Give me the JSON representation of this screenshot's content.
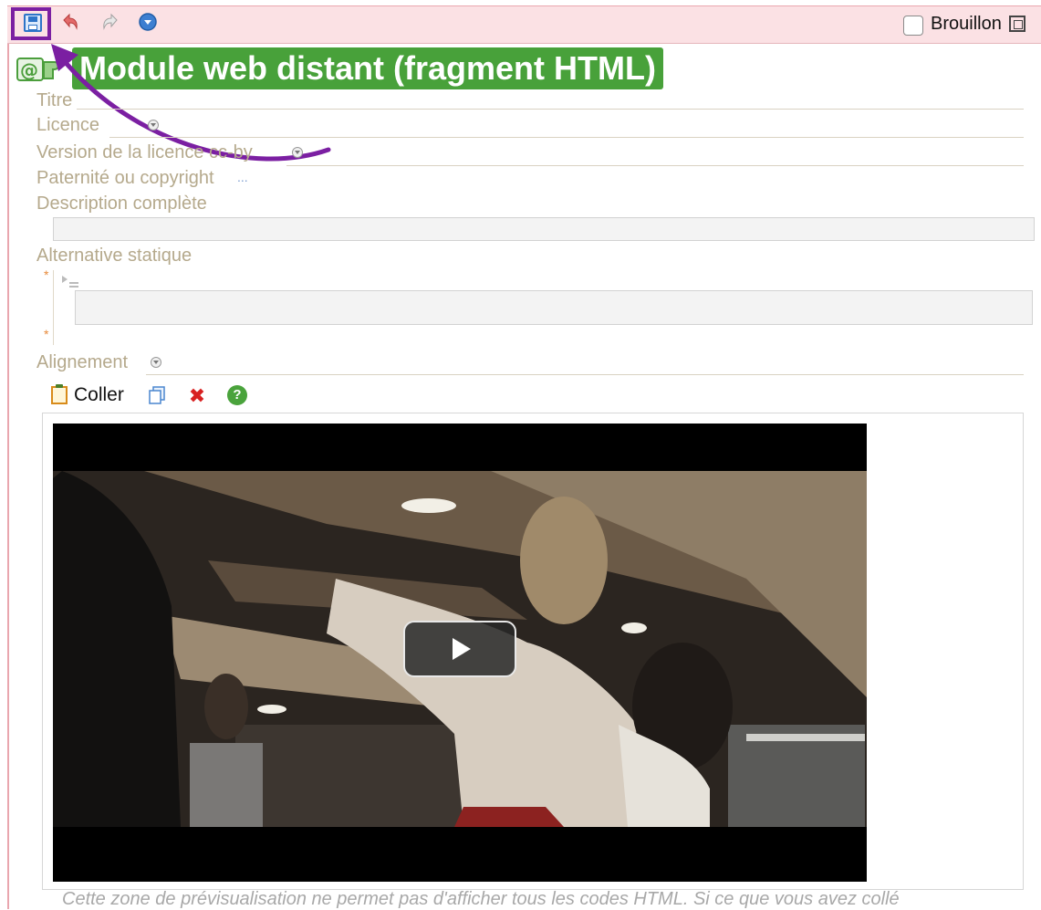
{
  "toolbar": {
    "draft_label": "Brouillon",
    "icons": [
      "save-icon",
      "undo-icon",
      "redo-icon",
      "menu-icon"
    ]
  },
  "module": {
    "title": "Module web distant (fragment HTML)"
  },
  "form": {
    "title_label": "Titre",
    "license_label": "Licence",
    "license_version_label": "Version de la licence cc-by",
    "copyright_label": "Paternité ou copyright",
    "copyright_more": "...",
    "description_label": "Description complète",
    "static_alt_label": "Alternative statique",
    "required_mark": "*",
    "alignment_label": "Alignement"
  },
  "editor": {
    "paste_label": "Coller",
    "help_glyph": "?"
  },
  "preview": {
    "note": "Cette zone de prévisualisation ne permet pas d'afficher tous les codes HTML. Si ce que vous avez collé"
  },
  "colors": {
    "toolbar_bg": "#fbe1e4",
    "highlight": "#7b1fa2",
    "title_bg": "#48a13a",
    "label": "#b5a98c"
  }
}
